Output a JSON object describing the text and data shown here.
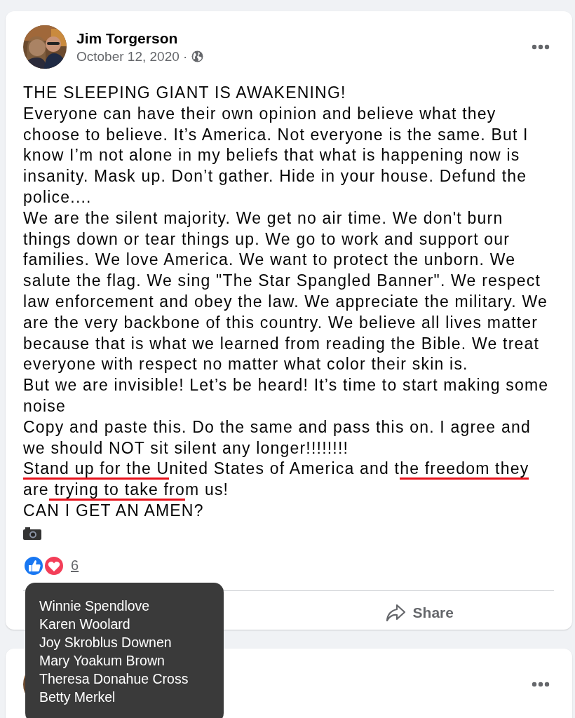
{
  "post": {
    "author": "Jim Torgerson",
    "date": "October 12, 2020 ·",
    "paragraphs": [
      "THE SLEEPING GIANT IS AWAKENING!",
      "Everyone can have their own opinion and believe what they choose to believe. It’s America. Not everyone is the same. But I know I’m not alone in my beliefs that what is happening now is insanity. Mask up. Don’t gather. Hide in your house. Defund the police....",
      "We are the silent majority. We get no air time. We don't burn things down or tear things up. We go to work and support our families. We love America. We want to protect the unborn. We salute the flag. We sing \"The Star Spangled Banner\". We respect law enforcement and obey the law. We appreciate the military. We are the very backbone of this country. We believe all lives matter because that is what we learned from reading the Bible. We treat everyone with respect no matter what color their skin is.",
      "But we are invisible! Let’s be heard! It’s time to start making some noise",
      "Copy and paste this. Do the same and pass this on. I agree and we should NOT sit silent any longer!!!!!!!!"
    ],
    "marked_paragraph": [
      {
        "text": "Stand up for the U",
        "underlined": true
      },
      {
        "text": "nited States of America and t",
        "underlined": false
      },
      {
        "text": "he freedom they ",
        "underlined": true
      },
      {
        "text": "are",
        "underlined": false
      },
      {
        "text": " trying to take fro",
        "underlined": true
      },
      {
        "text": "m us!",
        "underlined": false
      }
    ],
    "closing": "CAN I GET AN AMEN?",
    "reaction_count": "6",
    "share_label": "Share",
    "reactors": [
      "Winnie Spendlove",
      "Karen Woolard",
      "Joy Skroblus Downen",
      "Mary Yoakum Brown",
      "Theresa Donahue Cross",
      "Betty Merkel"
    ]
  }
}
